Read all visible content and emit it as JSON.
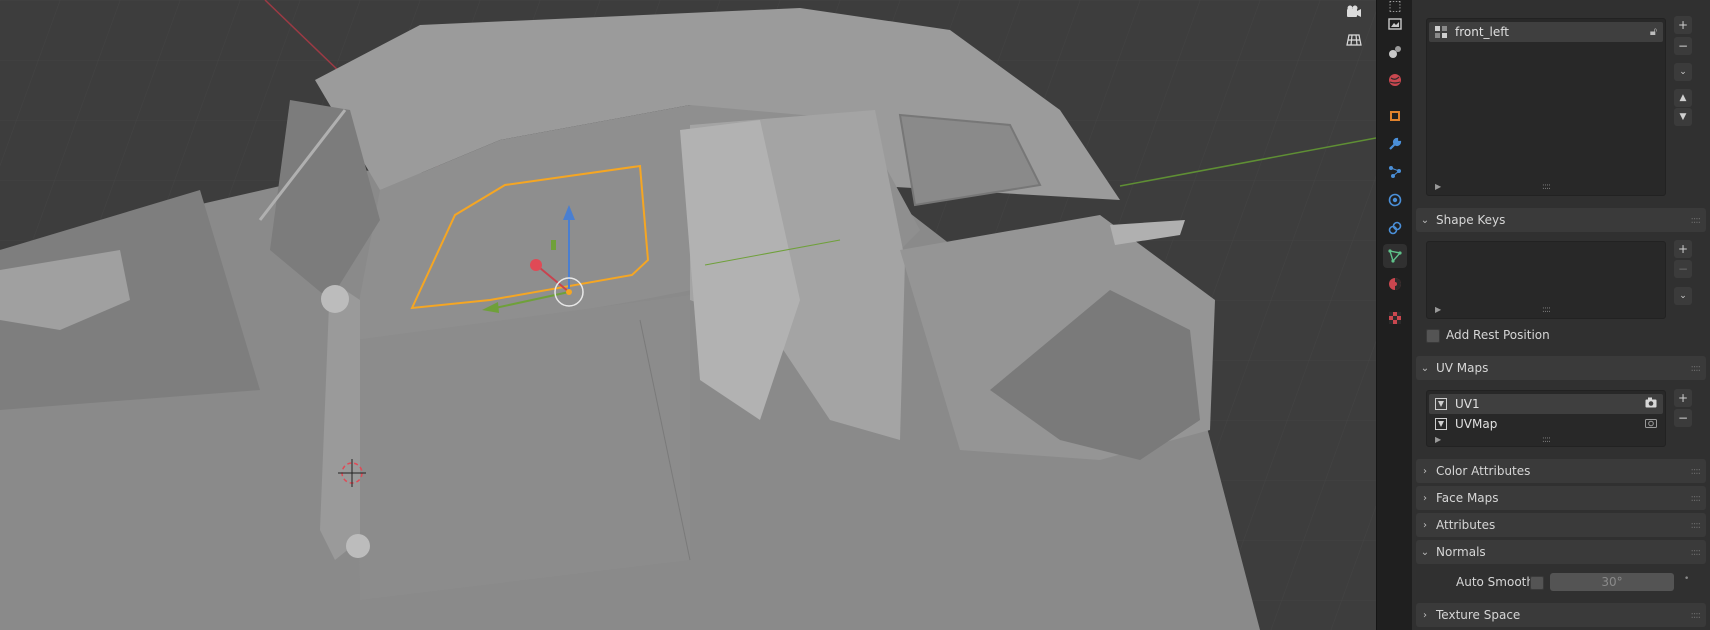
{
  "panel": {
    "vertex_groups": {
      "items": [
        {
          "label": "front_left",
          "lock_icon": "lock-open-icon",
          "selected": true
        }
      ]
    },
    "shape_keys": {
      "title": "Shape Keys",
      "add_rest_position_label": "Add Rest Position"
    },
    "uv_maps": {
      "title": "UV Maps",
      "items": [
        {
          "label": "UV1",
          "selected": true,
          "render_icon": "camera-icon"
        },
        {
          "label": "UVMap",
          "selected": false,
          "render_icon": "camera-icon"
        }
      ]
    },
    "color_attributes": {
      "title": "Color Attributes"
    },
    "face_maps": {
      "title": "Face Maps"
    },
    "attributes": {
      "title": "Attributes"
    },
    "normals": {
      "title": "Normals",
      "auto_smooth_label": "Auto Smooth",
      "angle_value": "30°"
    },
    "texture_space": {
      "title": "Texture Space"
    }
  },
  "tabs": [
    {
      "name": "tool-tab",
      "icon": "tool-icon"
    },
    {
      "name": "render-tab",
      "icon": "render-icon"
    },
    {
      "name": "output-tab",
      "icon": "output-icon"
    },
    {
      "name": "view-layer-tab",
      "icon": "view-layer-icon"
    },
    {
      "name": "scene-tab",
      "icon": "scene-icon"
    },
    {
      "name": "world-tab",
      "icon": "world-icon"
    },
    {
      "name": "object-tab",
      "icon": "object-icon"
    },
    {
      "name": "modifier-tab",
      "icon": "wrench-icon"
    },
    {
      "name": "particles-tab",
      "icon": "particles-icon"
    },
    {
      "name": "physics-tab",
      "icon": "physics-icon"
    },
    {
      "name": "constraints-tab",
      "icon": "constraints-icon"
    },
    {
      "name": "data-tab",
      "icon": "mesh-data-icon",
      "active": true
    },
    {
      "name": "material-tab",
      "icon": "material-icon"
    },
    {
      "name": "texture-tab",
      "icon": "texture-icon"
    }
  ],
  "colors": {
    "selection_outline": "#f5a623",
    "axis_x": "#c8434f",
    "axis_y": "#6fa03a",
    "axis_z": "#4a7fd1",
    "viewport_bg": "#3d3d3d",
    "panel_bg": "#303030"
  }
}
